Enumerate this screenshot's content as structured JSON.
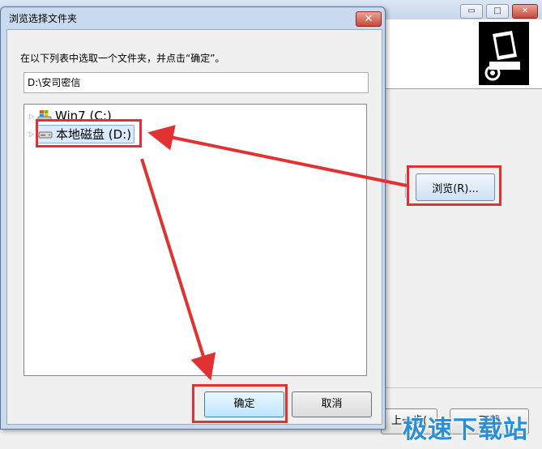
{
  "dialog": {
    "title": "浏览选择文件夹",
    "close_label": "✕",
    "instruction": "在以下列表中选取一个文件夹，并点击“确定”。",
    "path_value": "D:\\安司密信",
    "tree": [
      {
        "label": "Win7 (C:)",
        "icon": "system-drive-icon"
      },
      {
        "label": "本地磁盘 (D:)",
        "icon": "hard-drive-icon",
        "selected": true
      }
    ],
    "ok_label": "确定",
    "cancel_label": "取消"
  },
  "installer": {
    "minimize_label": "▭",
    "maximize_label": "□",
    "close_label": "✕",
    "browse_label": "浏览(R)...",
    "back_label": "上一步(",
    "next_label": "下载"
  },
  "watermark": "极速下载站",
  "colors": {
    "annotation_red": "#e03232",
    "title_gradient_top": "#dbe6f4",
    "watermark_blue": "#2a8ed6"
  }
}
